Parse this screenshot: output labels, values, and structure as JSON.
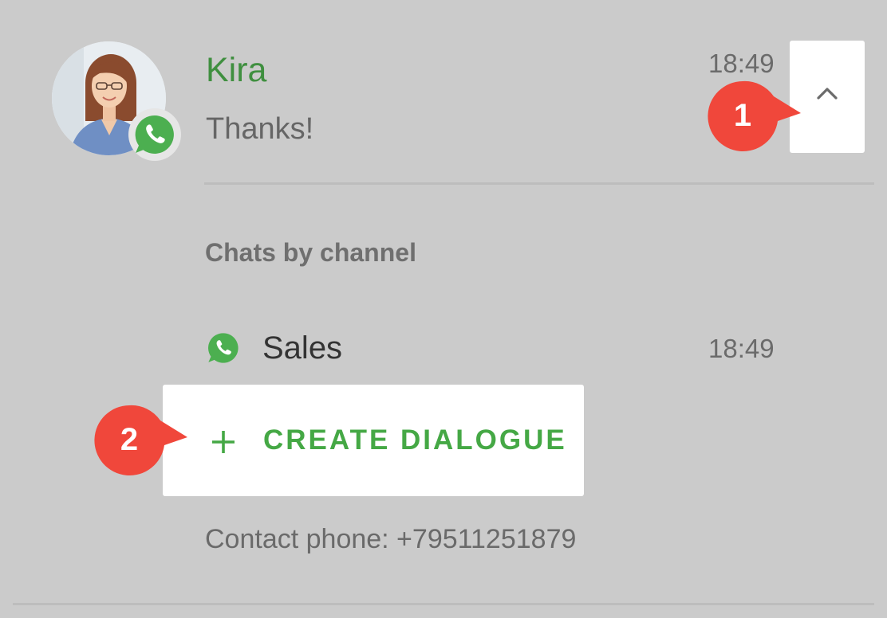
{
  "chat": {
    "contact_name": "Kira",
    "last_message": "Thanks!",
    "time": "18:49"
  },
  "channels": {
    "section_title": "Chats by channel",
    "items": [
      {
        "name": "Sales",
        "time": "18:49",
        "icon": "whatsapp-icon"
      }
    ]
  },
  "actions": {
    "create_dialogue_label": "CREATE DIALOGUE"
  },
  "contact": {
    "phone": "Contact phone: +79511251879"
  },
  "callouts": {
    "first": "1",
    "second": "2"
  },
  "icons": {
    "collapse": "chevron-up-icon",
    "badge": "whatsapp-icon",
    "create": "plus-icon"
  },
  "colors": {
    "background": "#cbcbcb",
    "accent_green": "#45a845",
    "name_green": "#3f8f3f",
    "whatsapp_green": "#4caf50",
    "callout_red": "#f0473b"
  }
}
